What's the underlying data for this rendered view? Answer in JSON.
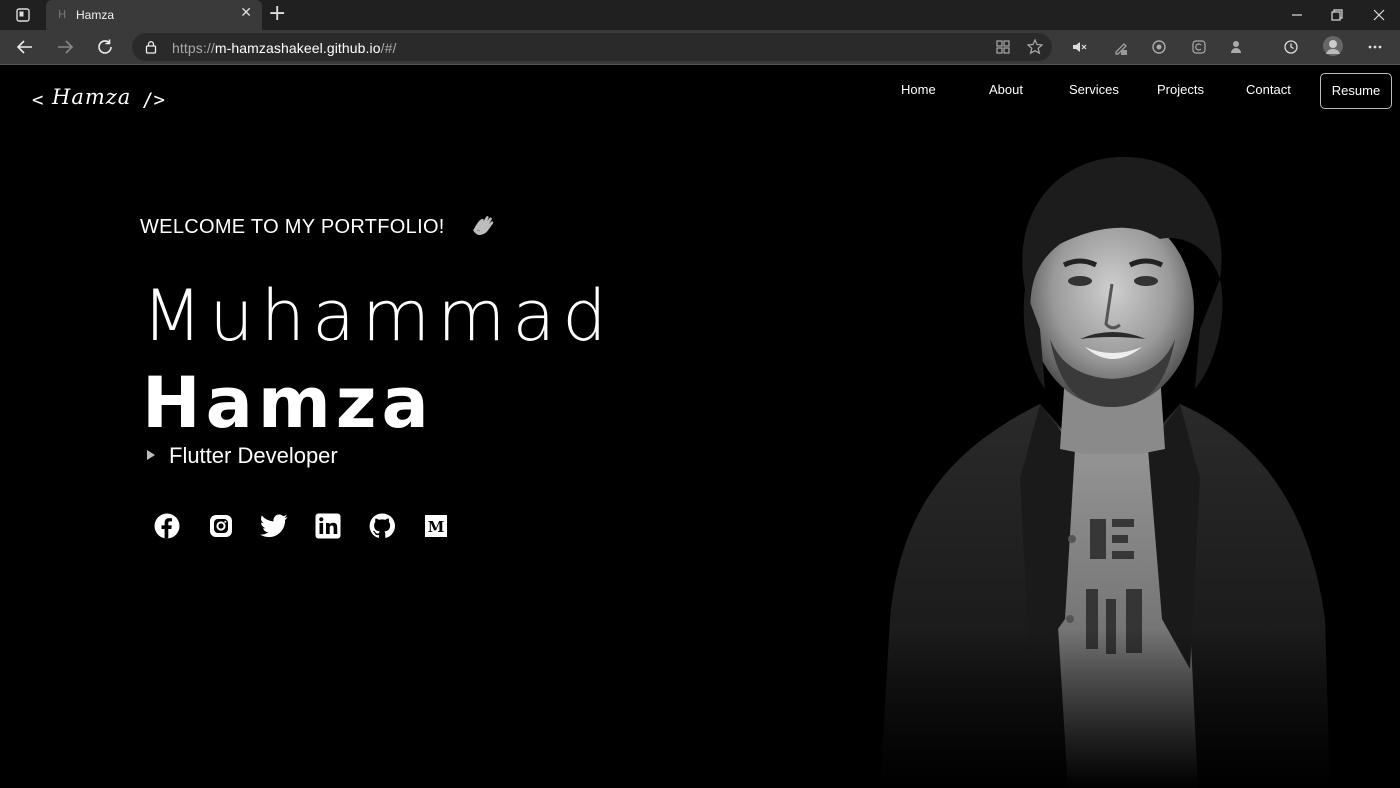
{
  "browser": {
    "tab_title": "Hamza",
    "tab_favicon": "H",
    "url_protocol": "https://",
    "url_host": "m-hamzashakeel.github.io",
    "url_path": "/#/"
  },
  "site": {
    "logo_open": "<",
    "logo_text": "Hamza",
    "logo_close": "/>",
    "nav": {
      "home": "Home",
      "about": "About",
      "services": "Services",
      "projects": "Projects",
      "contact": "Contact"
    },
    "resume_label": "Resume"
  },
  "hero": {
    "welcome": "WELCOME TO MY PORTFOLIO!",
    "first_name": "Muhammad",
    "last_name": "Hamza",
    "role": "Flutter Developer"
  },
  "social": {
    "icons": [
      "facebook-icon",
      "instagram-icon",
      "twitter-icon",
      "linkedin-icon",
      "github-icon",
      "medium-icon"
    ],
    "medium_letter": "M"
  },
  "colors": {
    "page_bg": "#000000",
    "text": "#ffffff",
    "chrome_tabbar": "#202020",
    "chrome_toolbar": "#3a3a3a"
  }
}
